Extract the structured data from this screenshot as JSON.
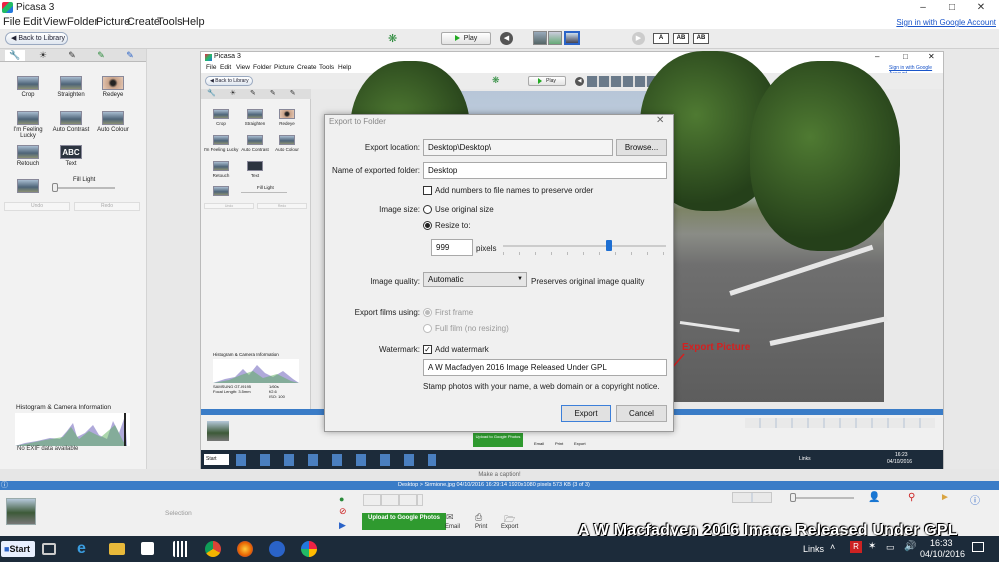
{
  "window": {
    "title": "Picasa 3",
    "signin": "Sign in with Google Account"
  },
  "menu": [
    "File",
    "Edit",
    "View",
    "Folder",
    "Picture",
    "Create",
    "Tools",
    "Help"
  ],
  "toolbar": {
    "back_label": "Back to Library",
    "play_label": "Play",
    "text_buttons": [
      "A",
      "AB",
      "AB"
    ]
  },
  "left_panel": {
    "tools": [
      {
        "label": "Crop"
      },
      {
        "label": "Straighten"
      },
      {
        "label": "Redeye"
      },
      {
        "label": "I'm Feeling Lucky"
      },
      {
        "label": "Auto Contrast"
      },
      {
        "label": "Auto Colour"
      },
      {
        "label": "Retouch"
      },
      {
        "label": "Text"
      }
    ],
    "fill_light": "Fill Light",
    "undo": "Undo",
    "redo": "Redo",
    "histogram_title": "Histogram & Camera Information",
    "no_exif": "No EXIF data available"
  },
  "inner": {
    "title": "Picasa 3",
    "signin": "Sign in with Google Account",
    "menu": [
      "File",
      "Edit",
      "View",
      "Folder",
      "Picture",
      "Create",
      "Tools",
      "Help"
    ],
    "back_label": "Back to Library",
    "play_label": "Play",
    "tools": [
      "Crop",
      "Straighten",
      "Redeye",
      "I'm Feeling Lucky",
      "Auto Contrast",
      "Auto Colour",
      "Retouch",
      "Text"
    ],
    "fill_light": "Fill Light",
    "undo": "Undo",
    "redo": "Redo",
    "histogram_title": "Histogram & Camera Information",
    "camera": "SAMSUNG GT-I9195",
    "focal": "Focal Length: 3.5mm",
    "exposure": [
      "1/60s",
      "f/2.6",
      "ISO: 100"
    ],
    "upload_label": "Upload to Google Photos",
    "actions": [
      "Email",
      "Print",
      "Export"
    ],
    "taskbar_links": "Links",
    "time": "16:23",
    "date": "04/10/2016",
    "start": "Start"
  },
  "annotation": {
    "text": "Export Picture",
    "color": "#d42020"
  },
  "dialog": {
    "title": "Export to Folder",
    "export_location_label": "Export location:",
    "export_location_value": "Desktop\\Desktop\\",
    "browse_label": "Browse...",
    "folder_name_label": "Name of exported folder:",
    "folder_name_value": "Desktop",
    "add_numbers_label": "Add numbers to file names to preserve order",
    "add_numbers_checked": false,
    "image_size_label": "Image size:",
    "use_original_label": "Use original size",
    "resize_label": "Resize to:",
    "resize_selected": true,
    "size_value": "999",
    "pixels_label": "pixels",
    "size_slider_fraction": 0.65,
    "image_quality_label": "Image quality:",
    "image_quality_value": "Automatic",
    "quality_note": "Preserves original image quality",
    "export_films_label": "Export films using:",
    "first_frame_label": "First frame",
    "full_film_label": "Full film (no resizing)",
    "watermark_label": "Watermark:",
    "add_watermark_label": "Add watermark",
    "add_watermark_checked": true,
    "watermark_value": "A W Macfadyen 2016  Image Released Under GPL",
    "watermark_hint": "Stamp photos with your name, a web domain or a copyright notice.",
    "export_button": "Export",
    "cancel_button": "Cancel"
  },
  "bottom": {
    "caption_placeholder": "Make a caption!",
    "status": "Desktop > Sirmione.jpg   04/10/2016 16:29:14   1920x1080 pixels   573 KB   (3 of 3)",
    "selection": "Selection",
    "upload_label": "Upload to Google Photos",
    "actions": [
      "Email",
      "Print",
      "Export"
    ]
  },
  "taskbar": {
    "start": "Start",
    "links": "Links",
    "time": "16:33",
    "date": "04/10/2016"
  },
  "watermark_overlay": "A W Macfadyen 2016  Image Released Under GPL"
}
